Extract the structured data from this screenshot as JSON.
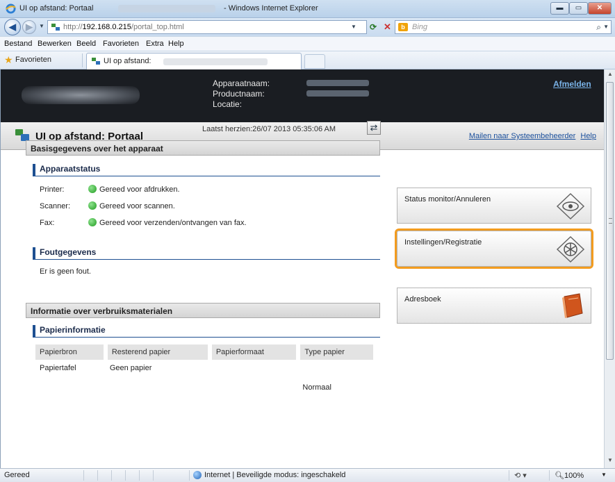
{
  "browser": {
    "window_title": "UI op afstand: Portaal",
    "window_title_suffix": "- Windows Internet Explorer",
    "url_prefix": "http://",
    "url_host": "192.168.0.215",
    "url_path": "/portal_top.html",
    "search_placeholder": "Bing",
    "menu": [
      "Bestand",
      "Bewerken",
      "Beeld",
      "Favorieten",
      "Extra",
      "Help"
    ],
    "favorites_label": "Favorieten",
    "tab_label": "UI op afstand:",
    "status_text": "Gereed",
    "zone_text": "Internet | Beveiligde modus: ingeschakeld",
    "zoom": "100%"
  },
  "header": {
    "labels": [
      "Apparaatnaam:",
      "Productnaam:",
      "Locatie:"
    ],
    "logout": "Afmelden"
  },
  "portal": {
    "title": "UI op afstand: Portaal",
    "link_mail": "Mailen naar Systeembeheerder",
    "link_help": "Help",
    "last_updated": "Laatst herzien:26/07 2013 05:35:06 AM"
  },
  "device": {
    "section_title": "Basisgegevens over het apparaat",
    "status_heading": "Apparaatstatus",
    "status": [
      {
        "label": "Printer:",
        "value": "Gereed voor afdrukken."
      },
      {
        "label": "Scanner:",
        "value": "Gereed voor scannen."
      },
      {
        "label": "Fax:",
        "value": "Gereed voor verzenden/ontvangen van fax."
      }
    ],
    "error_heading": "Foutgegevens",
    "error_text": "Er is geen fout."
  },
  "consumables": {
    "section_title": "Informatie over verbruiksmaterialen",
    "paper_heading": "Papierinformatie",
    "columns": [
      "Papierbron",
      "Resterend papier",
      "Papierformaat",
      "Type papier"
    ],
    "rows": [
      [
        "Papiertafel",
        "Geen papier",
        "",
        ""
      ],
      [
        "",
        "",
        "",
        "Normaal"
      ]
    ]
  },
  "tiles": [
    {
      "label": "Status monitor/Annuleren",
      "icon": "eye-diamond-icon"
    },
    {
      "label": "Instellingen/Registratie",
      "icon": "settings-diamond-icon"
    },
    {
      "label": "Adresboek",
      "icon": "address-book-icon"
    }
  ],
  "colors": {
    "highlight": "#f39c1f",
    "header_bg": "#1a1d22",
    "link": "#1a4f9c"
  }
}
